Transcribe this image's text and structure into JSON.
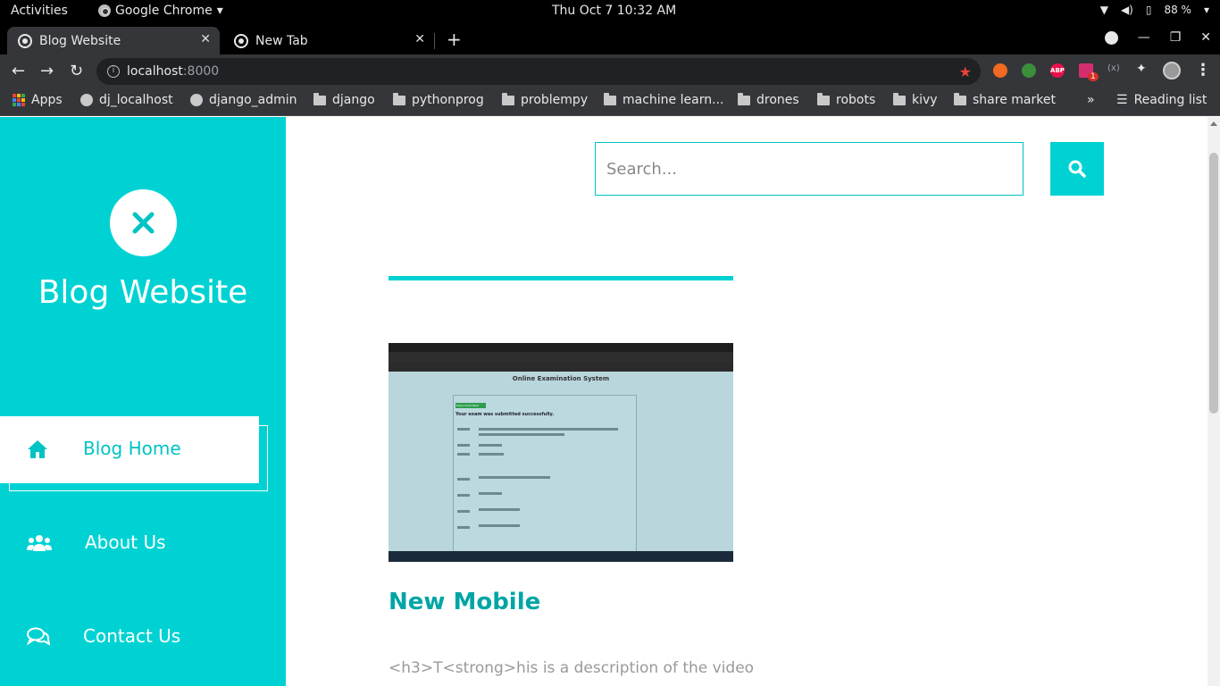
{
  "os_bar": {
    "activities": "Activities",
    "app_name": "Google Chrome",
    "clock": "Thu Oct 7  10:32 AM",
    "battery": "88 %"
  },
  "browser": {
    "tabs": [
      {
        "title": "Blog Website",
        "active": true
      },
      {
        "title": "New Tab",
        "active": false
      }
    ],
    "address": {
      "host": "localhost",
      "port": ":8000"
    },
    "bookmarks": [
      {
        "label": "Apps",
        "icon": "apps-grid-icon"
      },
      {
        "label": "dj_localhost",
        "icon": "globe-icon"
      },
      {
        "label": "django_admin",
        "icon": "globe-icon"
      },
      {
        "label": "django",
        "icon": "folder-icon"
      },
      {
        "label": "pythonprog",
        "icon": "folder-icon"
      },
      {
        "label": "problempy",
        "icon": "folder-icon"
      },
      {
        "label": "machine learn...",
        "icon": "folder-icon"
      },
      {
        "label": "drones",
        "icon": "folder-icon"
      },
      {
        "label": "robots",
        "icon": "folder-icon"
      },
      {
        "label": "kivy",
        "icon": "folder-icon"
      },
      {
        "label": "share market",
        "icon": "folder-icon"
      }
    ],
    "bookmarks_overflow": "»",
    "reading_list": "Reading list",
    "extensions": {
      "abp": "ABP",
      "badge": "1"
    }
  },
  "site": {
    "title": "Blog Website",
    "accent_color": "#00d2d3",
    "nav": [
      {
        "label": "Blog Home",
        "icon": "home-icon",
        "active": true
      },
      {
        "label": "About Us",
        "icon": "users-icon",
        "active": false
      },
      {
        "label": "Contact Us",
        "icon": "chat-icon",
        "active": false
      }
    ],
    "search": {
      "placeholder": "Search..."
    },
    "post": {
      "title": "New Mobile",
      "description": "<h3>T<strong>his is a description of the video",
      "thumbnail": {
        "heading": "Online Examination System",
        "badge": "Exam Submitted",
        "message": "Your exam was submitted successfully."
      }
    }
  }
}
